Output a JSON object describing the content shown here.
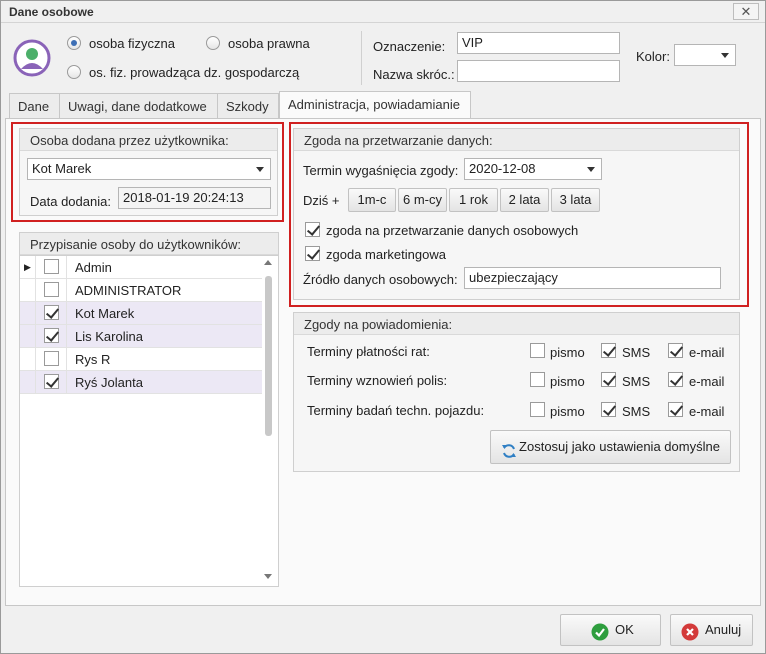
{
  "window": {
    "title": "Dane osobowe",
    "close_glyph": "✕"
  },
  "header": {
    "avatar_icon": "user-avatar-icon",
    "radio_options": [
      {
        "label": "osoba fizyczna",
        "checked": true
      },
      {
        "label": "osoba prawna",
        "checked": false
      },
      {
        "label": "os. fiz. prowadząca dz. gospodarczą",
        "checked": false
      }
    ],
    "oznaczenie_label": "Oznaczenie:",
    "oznaczenie_value": "VIP",
    "nazwa_label": "Nazwa skróc.:",
    "nazwa_value": "",
    "kolor_label": "Kolor:",
    "kolor_value": ""
  },
  "tabs": [
    {
      "label": "Dane",
      "active": false
    },
    {
      "label": "Uwagi, dane dodatkowe",
      "active": false
    },
    {
      "label": "Szkody",
      "active": false
    },
    {
      "label": "Administracja, powiadamianie",
      "active": true
    }
  ],
  "added_by": {
    "heading": "Osoba dodana przez użytkownika:",
    "user_value": "Kot Marek",
    "date_label": "Data dodania:",
    "date_value": "2018-01-19  20:24:13"
  },
  "assignment": {
    "heading": "Przypisanie osoby do użytkowników:",
    "rows": [
      {
        "name": "Admin",
        "checked": false,
        "current": true,
        "selected": false
      },
      {
        "name": "ADMINISTRATOR",
        "checked": false,
        "current": false,
        "selected": false
      },
      {
        "name": "Kot Marek",
        "checked": true,
        "current": false,
        "selected": true
      },
      {
        "name": "Lis Karolina",
        "checked": true,
        "current": false,
        "selected": true
      },
      {
        "name": "Rys R",
        "checked": false,
        "current": false,
        "selected": false
      },
      {
        "name": "Ryś Jolanta",
        "checked": true,
        "current": false,
        "selected": true
      }
    ]
  },
  "consent": {
    "heading": "Zgoda na przetwarzanie danych:",
    "expiry_label": "Termin wygaśnięcia zgody:",
    "expiry_value": "2020-12-08",
    "today_label": "Dziś +",
    "quick_buttons": [
      "1m-c",
      "6 m-cy",
      "1 rok",
      "2 lata",
      "3 lata"
    ],
    "checkbox_processing": "zgoda na przetwarzanie danych osobowych",
    "checkbox_marketing": "zgoda marketingowa",
    "source_label": "Źródło danych osobowych:",
    "source_value": "ubezpieczający"
  },
  "notifications": {
    "heading": "Zgody na powiadomienia:",
    "rows": [
      {
        "label": "Terminy płatności rat:",
        "pismo": false,
        "sms": true,
        "email": true
      },
      {
        "label": "Terminy wznowień polis:",
        "pismo": false,
        "sms": true,
        "email": true
      },
      {
        "label": "Terminy badań techn. pojazdu:",
        "pismo": false,
        "sms": true,
        "email": true
      }
    ],
    "col_pismo": "pismo",
    "col_sms": "SMS",
    "col_email": "e-mail",
    "default_button": "Zostosuj jako ustawienia domyślne"
  },
  "footer": {
    "ok_label": "OK",
    "cancel_label": "Anuluj"
  },
  "colors": {
    "accent": "#3d6fb5",
    "highlight": "#d02020",
    "ok": "#2e9e3e",
    "cancel": "#d33a3a"
  }
}
